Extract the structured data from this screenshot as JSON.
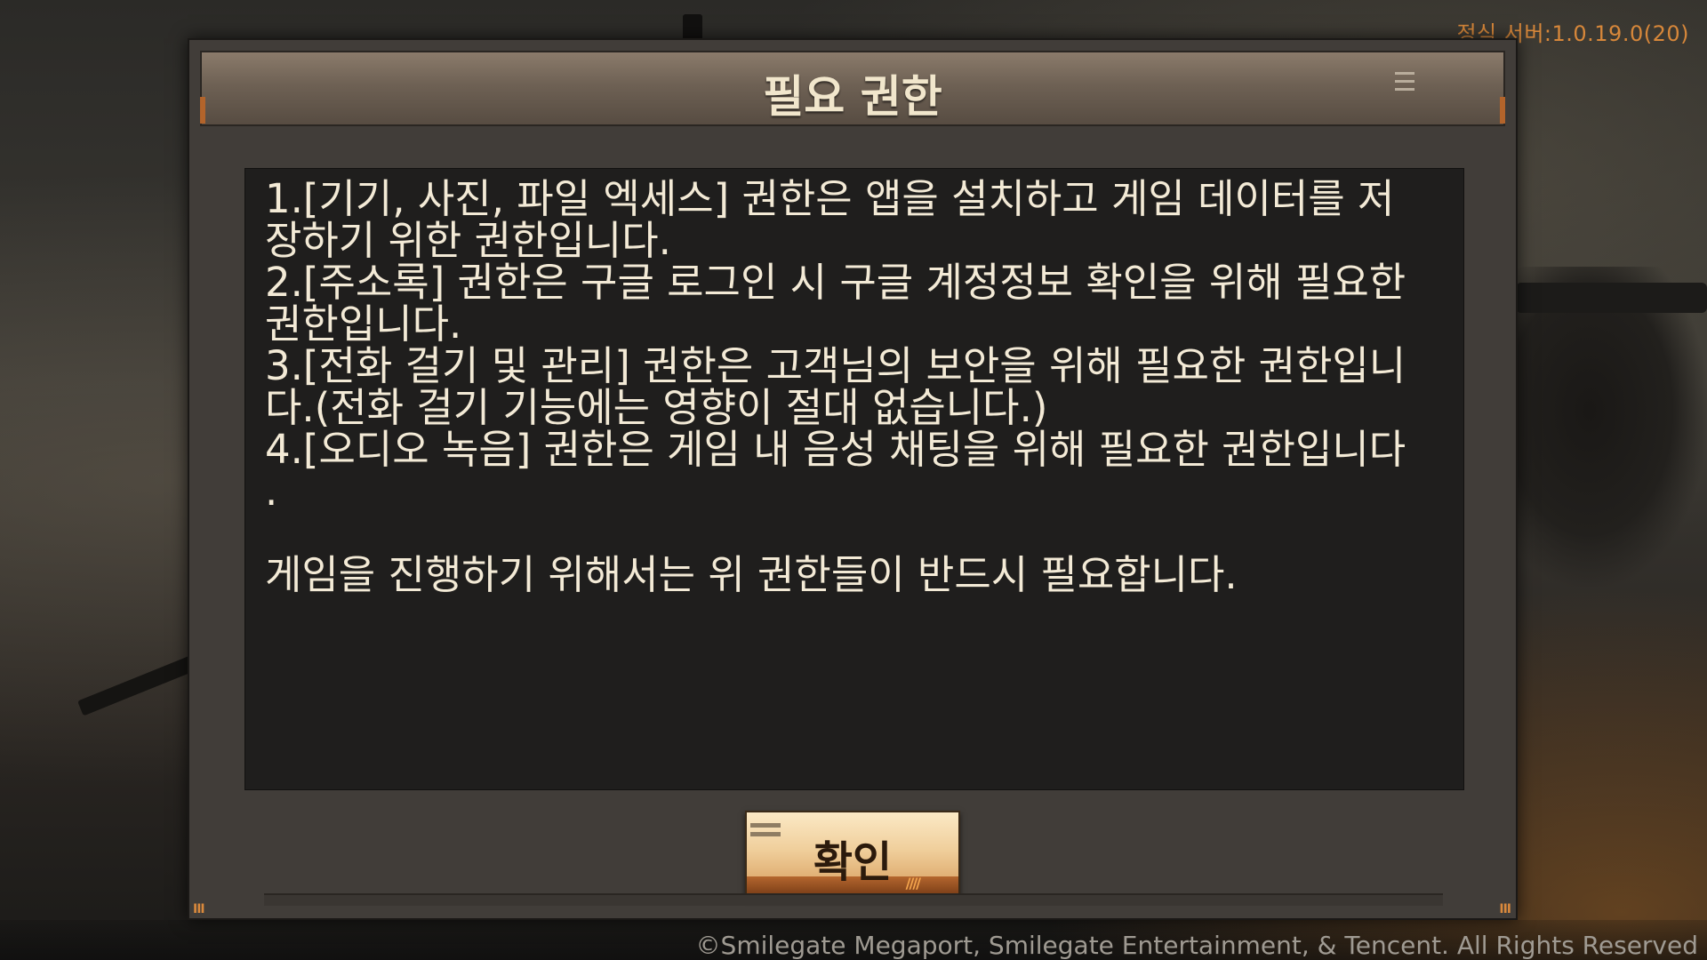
{
  "server_version": "정식 서버:1.0.19.0(20)",
  "copyright": "©Smilegate Megaport, Smilegate Entertainment, & Tencent. All Rights Reserved",
  "dialog": {
    "title": "필요 권한",
    "content_lines": [
      "1.[기기, 사진, 파일 엑세스] 권한은 앱을 설치하고 게임 데이터를 저",
      "장하기 위한 권한입니다.",
      "2.[주소록] 권한은 구글 로그인 시 구글 계정정보 확인을 위해 필요한",
      "권한입니다.",
      "3.[전화 걸기 및 관리] 권한은 고객님의 보안을 위해 필요한 권한입니",
      "다.(전화 걸기 기능에는 영향이 절대 없습니다.)",
      "4.[오디오 녹음] 권한은 게임 내 음성 채팅을 위해 필요한 권한입니다",
      ".",
      "게임을 진행하기 위해서는 위 권한들이 반드시 필요합니다."
    ],
    "confirm_label": "확인",
    "menu_icon": "hamburger-menu-icon",
    "footer_mark": "III"
  },
  "colors": {
    "accent_orange": "#d7873a",
    "dialog_text": "#f3ead6",
    "panel_bg": "#1f1e1d"
  }
}
